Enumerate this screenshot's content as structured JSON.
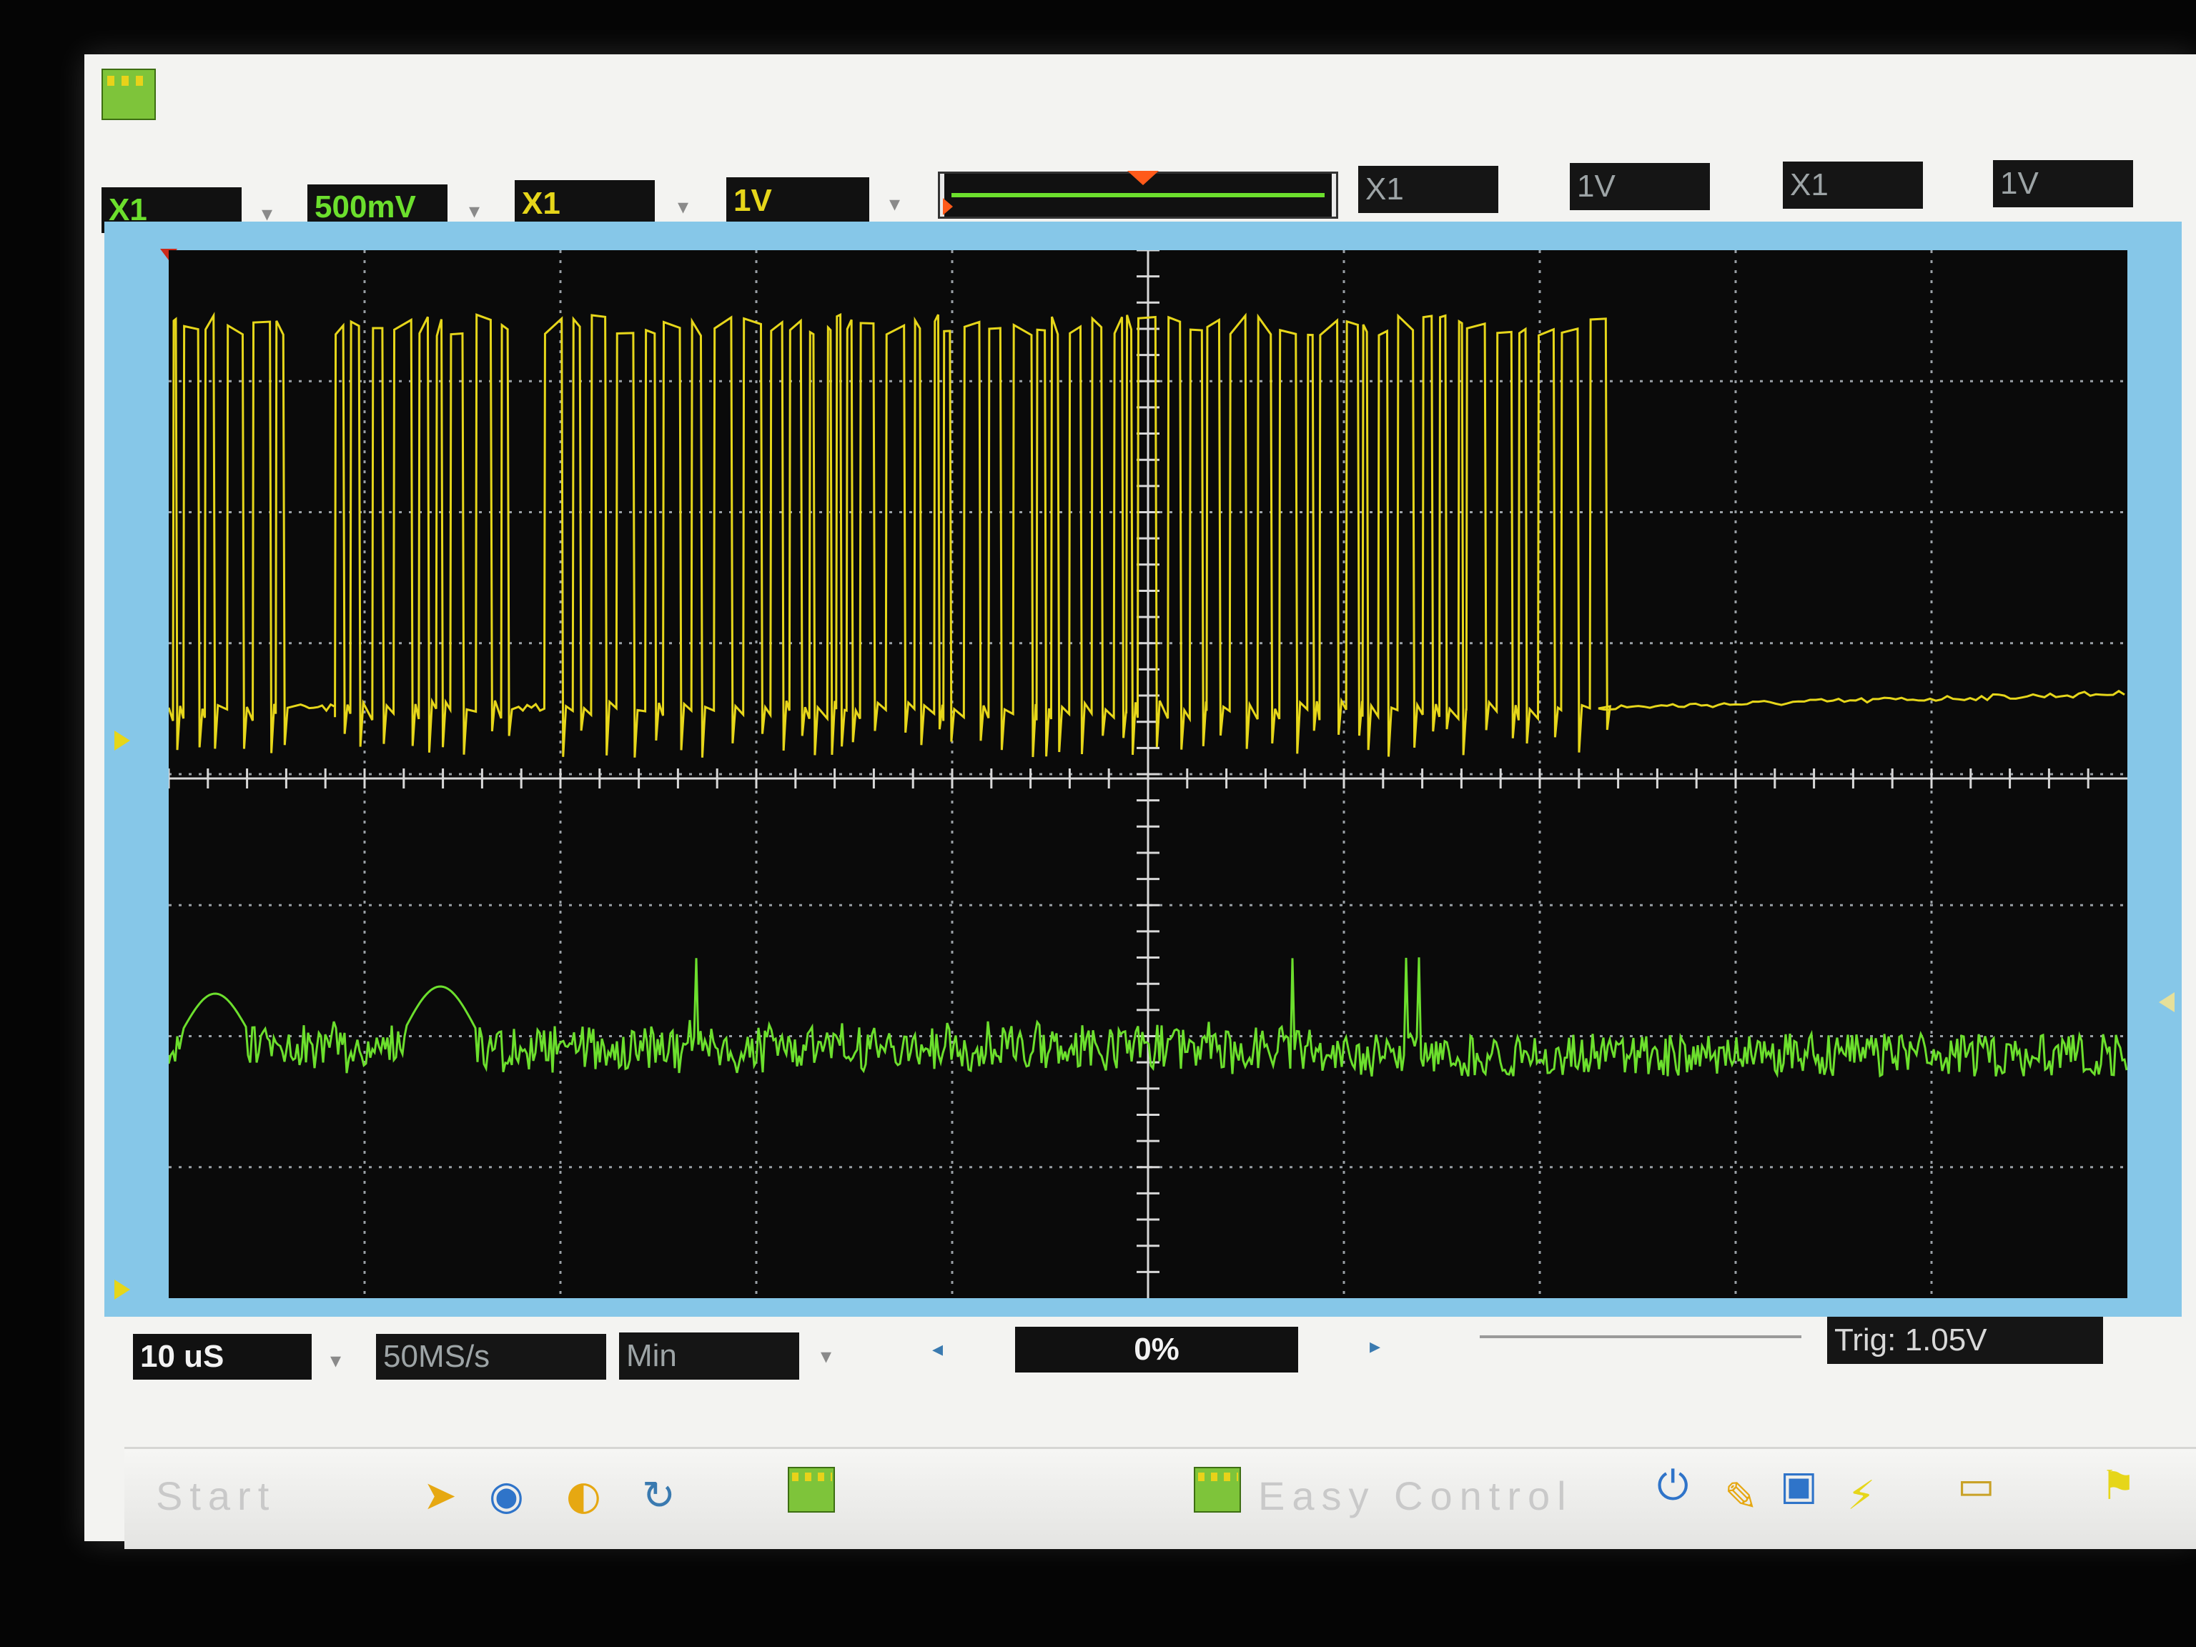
{
  "channel1": {
    "probe": "X1",
    "volts_div": "500mV"
  },
  "channel2": {
    "probe": "X1",
    "volts_div": "1V"
  },
  "channel3": {
    "probe": "X1",
    "volts_div": "1V"
  },
  "channel4": {
    "probe": "X1",
    "volts_div": "1V"
  },
  "timebase": {
    "time_div": "10 uS",
    "sample_rate": "50MS/s",
    "mode": "Min",
    "position": "0%",
    "trigger": "Trig: 1.05V"
  },
  "taskbar": {
    "start_label": "Start",
    "app_label": "Easy Control"
  },
  "colors": {
    "channel1": "#e6d61a",
    "channel2": "#6cdf2d",
    "plot_background": "#0a0a0a",
    "frame": "#86c7e8"
  },
  "icons": {
    "app": "oscilloscope-app-icon",
    "dropdown": "chevron-down-icon",
    "scroll_left": "triangle-left-icon",
    "scroll_right": "triangle-right-icon",
    "trigger_marker": "trigger-marker-icon"
  }
}
